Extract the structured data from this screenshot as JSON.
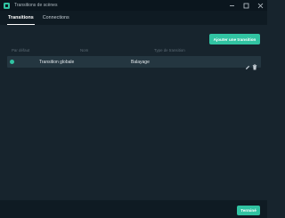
{
  "window": {
    "title": "Transitions de scènes"
  },
  "tabs": [
    {
      "label": "Transitions",
      "active": true
    },
    {
      "label": "Connections",
      "active": false
    }
  ],
  "toolbar": {
    "add_transition_label": "Ajouter une transition"
  },
  "table": {
    "columns": [
      "Par défaut",
      "Nom",
      "Type de transition"
    ],
    "rows": [
      {
        "is_default": true,
        "name": "Transition globale",
        "type": "Balayage"
      }
    ]
  },
  "footer": {
    "done_label": "Terminé"
  },
  "colors": {
    "accent": "#31c3a2",
    "background": "#17242d",
    "titlebar": "#0b161e",
    "row": "#243640"
  },
  "icons": {
    "app": "streamlabs-logo-icon",
    "edit": "pencil-icon",
    "delete": "trash-icon",
    "minimize": "minimize-icon",
    "maximize": "maximize-icon",
    "close": "close-icon",
    "default": "default-indicator-icon"
  }
}
